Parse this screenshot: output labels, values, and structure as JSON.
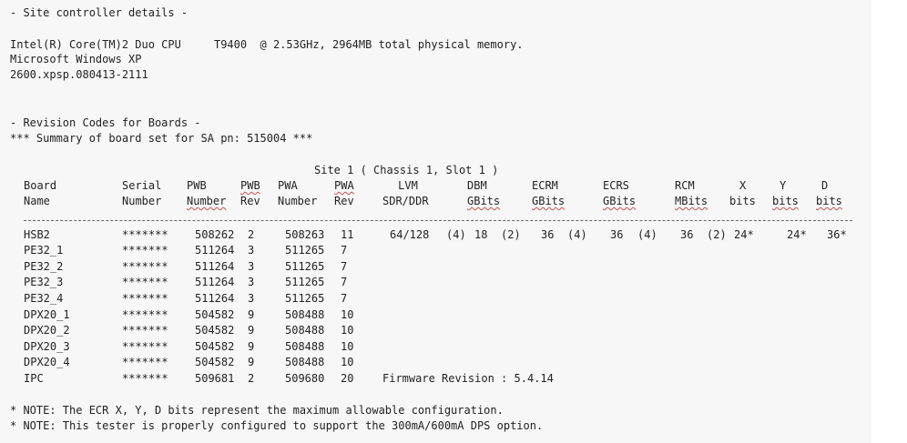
{
  "site_controller": {
    "heading": "- Site controller details -",
    "cpu_line": "Intel(R) Core(TM)2 Duo CPU     T9400  @ 2.53GHz, 2964MB total physical memory.",
    "os_line": "Microsoft Windows XP",
    "build_line": "2600.xpsp.080413-2111"
  },
  "revision": {
    "heading": "- Revision Codes for Boards -",
    "summary": "*** Summary of board set for SA pn: 515004 ***",
    "site_title": "Site 1 ( Chassis 1, Slot 1 )"
  },
  "columns": {
    "board": [
      "Board",
      "Name"
    ],
    "serial": [
      "Serial",
      "Number"
    ],
    "pwb_num": [
      "PWB",
      "Number"
    ],
    "pwb_rev": [
      "PWB",
      "Rev"
    ],
    "pwa_num": [
      "PWA",
      "Number"
    ],
    "pwa_rev": [
      "PWA",
      "Rev"
    ],
    "lvm": [
      "LVM",
      "SDR/DDR"
    ],
    "dbm": [
      "DBM",
      "GBits"
    ],
    "ecrm": [
      "ECRM",
      "GBits"
    ],
    "ecrs": [
      "ECRS",
      "GBits"
    ],
    "rcm": [
      "RCM",
      "MBits"
    ],
    "x": [
      "X",
      "bits"
    ],
    "y": [
      "Y",
      "bits"
    ],
    "d": [
      "D",
      "bits"
    ]
  },
  "rows": [
    {
      "board": "HSB2",
      "serial": "*******",
      "pwb": "508262",
      "pwb_rev": "2",
      "pwa": "508263",
      "pwa_rev": "11",
      "lvm": "64/128",
      "dbm_n": "(4)",
      "dbm": "18",
      "ecrm_n": "(2)",
      "ecrm": "36",
      "ecrs_n": "(4)",
      "ecrs": "36",
      "rcm_n": "(4)",
      "rcm": "36",
      "x_n": "(2)",
      "x": "24*",
      "y": "24*",
      "d": "36*"
    },
    {
      "board": "PE32_1",
      "serial": "*******",
      "pwb": "511264",
      "pwb_rev": "3",
      "pwa": "511265",
      "pwa_rev": "7"
    },
    {
      "board": "PE32_2",
      "serial": "*******",
      "pwb": "511264",
      "pwb_rev": "3",
      "pwa": "511265",
      "pwa_rev": "7"
    },
    {
      "board": "PE32_3",
      "serial": "*******",
      "pwb": "511264",
      "pwb_rev": "3",
      "pwa": "511265",
      "pwa_rev": "7"
    },
    {
      "board": "PE32_4",
      "serial": "*******",
      "pwb": "511264",
      "pwb_rev": "3",
      "pwa": "511265",
      "pwa_rev": "7"
    },
    {
      "board": "DPX20_1",
      "serial": "*******",
      "pwb": "504582",
      "pwb_rev": "9",
      "pwa": "508488",
      "pwa_rev": "10"
    },
    {
      "board": "DPX20_2",
      "serial": "*******",
      "pwb": "504582",
      "pwb_rev": "9",
      "pwa": "508488",
      "pwa_rev": "10"
    },
    {
      "board": "DPX20_3",
      "serial": "*******",
      "pwb": "504582",
      "pwb_rev": "9",
      "pwa": "508488",
      "pwa_rev": "10"
    },
    {
      "board": "DPX20_4",
      "serial": "*******",
      "pwb": "504582",
      "pwb_rev": "9",
      "pwa": "508488",
      "pwa_rev": "10"
    },
    {
      "board": "IPC",
      "serial": "*******",
      "pwb": "509681",
      "pwb_rev": "2",
      "pwa": "509680",
      "pwa_rev": "20",
      "extra": "Firmware Revision : 5.4.14"
    }
  ],
  "notes": [
    "* NOTE: The ECR X, Y, D bits represent the maximum allowable configuration.",
    "* NOTE: This tester is properly configured to support the 300mA/600mA DPS option."
  ]
}
